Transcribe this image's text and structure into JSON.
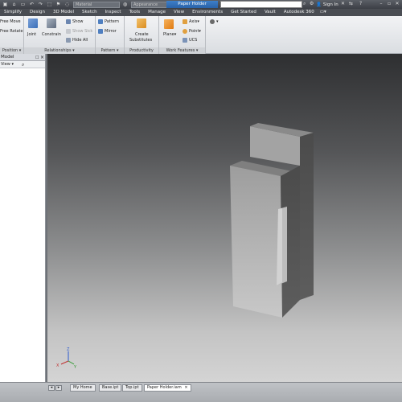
{
  "titlebar": {
    "material_dropdown": "Material",
    "appearance_dropdown": "Appearance",
    "document_title": "Paper Holder",
    "sign_in": "Sign In",
    "help": "?"
  },
  "menu": {
    "tabs": [
      "Simplify",
      "Design",
      "3D Model",
      "Sketch",
      "Inspect",
      "Tools",
      "Manage",
      "View",
      "Environments",
      "Get Started",
      "Vault",
      "Autodesk 360"
    ]
  },
  "ribbon": {
    "position": {
      "label": "Position",
      "free_move": "Free Move",
      "free_rotate": "Free Rotate"
    },
    "relationships": {
      "label": "Relationships",
      "joint": "Joint",
      "constrain": "Constrain",
      "show": "Show",
      "show_sick": "Show Sick",
      "hide_all": "Hide All"
    },
    "pattern": {
      "label": "Pattern",
      "pattern": "Pattern",
      "mirror": "Mirror"
    },
    "productivity": {
      "label": "Productivity",
      "create_substitutes_1": "Create",
      "create_substitutes_2": "Substitutes"
    },
    "work_features": {
      "label": "Work Features",
      "plane": "Plane",
      "axis": "Axis",
      "point": "Point",
      "ucs": "UCS"
    }
  },
  "browser": {
    "title": "Model",
    "view_label": "View",
    "pin": "☐",
    "close": "×"
  },
  "viewport": {
    "axis_z": "Z",
    "axis_x": "X",
    "axis_y": "Y"
  },
  "doc_tabs": [
    "My Home",
    "Base.ipt",
    "Top.ipt",
    "Paper Holder.iam"
  ],
  "doc_tab_close": "×",
  "colors": {
    "accent": "#2a62a8",
    "part_front": "#b0b0b0",
    "part_top": "#8f8f8f",
    "part_side": "#5c5c5c"
  }
}
